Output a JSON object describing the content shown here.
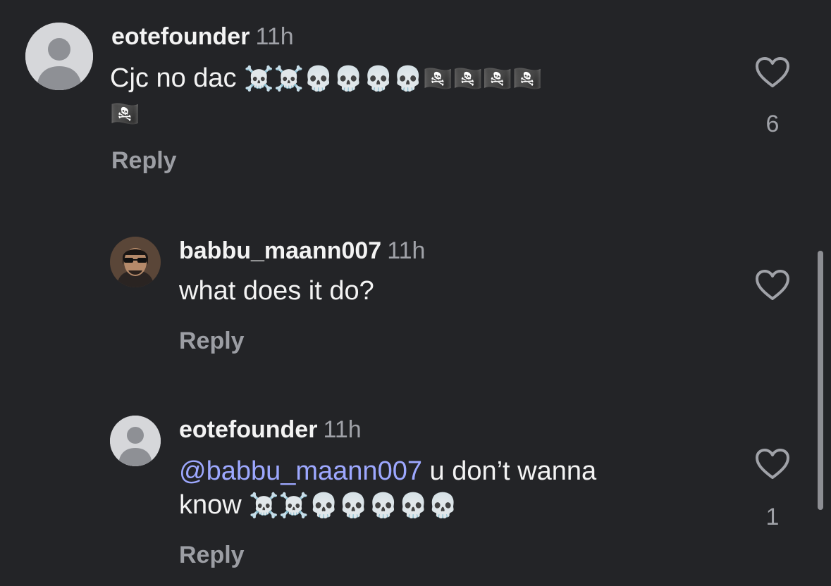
{
  "comments": [
    {
      "username": "eotefounder",
      "time": "11h",
      "text": "Cjc no dac",
      "emojis_line1": "☠️☠️💀💀💀💀🏴‍☠️🏴‍☠️🏴‍☠️🏴‍☠️",
      "emojis_line2": "🏴‍☠️",
      "reply_label": "Reply",
      "likes": "6",
      "avatar": "default-avatar-icon"
    },
    {
      "username": "babbu_maann007",
      "time": "11h",
      "text": "what does it do?",
      "reply_label": "Reply",
      "likes": "",
      "avatar": "profile-photo"
    },
    {
      "username": "eotefounder",
      "time": "11h",
      "mention": "@babbu_maann007",
      "text_after_mention": " u don’t wanna",
      "text_line2": "know",
      "emojis": "☠️☠️💀💀💀💀💀",
      "reply_label": "Reply",
      "likes": "1",
      "avatar": "default-avatar-icon"
    }
  ],
  "colors": {
    "background": "#232427",
    "mention": "#9da8ff",
    "secondary_text": "#a0a2a8"
  }
}
